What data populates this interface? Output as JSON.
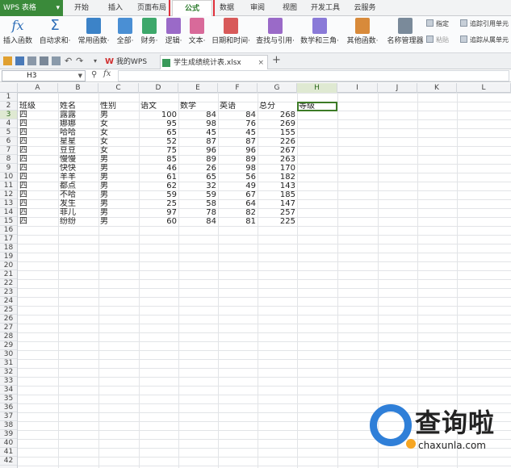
{
  "app": {
    "name": "WPS 表格",
    "caret": "▾"
  },
  "menu_tabs": [
    "开始",
    "插入",
    "页面布局",
    "公式",
    "数据",
    "审阅",
    "视图",
    "开发工具",
    "云服务"
  ],
  "ribbon": {
    "buttons": [
      {
        "label": "插入函数",
        "icon": "fx-icon"
      },
      {
        "label": "自动求和·",
        "icon": "sigma-icon"
      },
      {
        "label": "常用函数·",
        "icon": "star-function-icon"
      },
      {
        "label": "全部·",
        "icon": "book-icon"
      },
      {
        "label": "财务·",
        "icon": "finance-icon"
      },
      {
        "label": "逻辑·",
        "icon": "logic-icon"
      },
      {
        "label": "文本·",
        "icon": "text-icon"
      },
      {
        "label": "日期和时间·",
        "icon": "calendar-icon"
      },
      {
        "label": "查找与引用·",
        "icon": "lookup-icon"
      },
      {
        "label": "数学和三角·",
        "icon": "math-icon"
      },
      {
        "label": "其他函数·",
        "icon": "more-functions-icon"
      },
      {
        "label": "名称管理器",
        "icon": "name-manager-icon"
      }
    ],
    "small": [
      "指定",
      "粘贴",
      "追踪引用单元",
      "追踪从属单元"
    ]
  },
  "quickbar": {
    "tabs": [
      {
        "label": "我的WPS"
      },
      {
        "label": "学生成绩统计表.xlsx"
      }
    ],
    "close": "×",
    "add": "+"
  },
  "formula_bar": {
    "name_box": "H3",
    "fx": "fx",
    "value": ""
  },
  "columns": [
    "A",
    "B",
    "C",
    "D",
    "E",
    "F",
    "G",
    "H",
    "I",
    "J",
    "K",
    "L"
  ],
  "rows": [
    "1",
    "2",
    "3",
    "4",
    "5",
    "6",
    "7",
    "8",
    "9",
    "10",
    "11",
    "12",
    "13",
    "14",
    "15",
    "16",
    "17",
    "18",
    "19",
    "20",
    "21",
    "22",
    "23",
    "24",
    "25",
    "26",
    "27",
    "28",
    "29",
    "30",
    "31",
    "32",
    "33",
    "34",
    "35",
    "36",
    "37",
    "38",
    "39",
    "40",
    "41",
    "42"
  ],
  "header_row": [
    "班级",
    "姓名",
    "性别",
    "语文",
    "数学",
    "英语",
    "总分",
    "等级"
  ],
  "table": [
    [
      "四",
      "露露",
      "男",
      "100",
      "84",
      "84",
      "268"
    ],
    [
      "四",
      "娜娜",
      "女",
      "95",
      "98",
      "76",
      "269"
    ],
    [
      "四",
      "哈哈",
      "女",
      "65",
      "45",
      "45",
      "155"
    ],
    [
      "四",
      "星星",
      "女",
      "52",
      "87",
      "87",
      "226"
    ],
    [
      "四",
      "豆豆",
      "女",
      "75",
      "96",
      "96",
      "267"
    ],
    [
      "四",
      "慢慢",
      "男",
      "85",
      "89",
      "89",
      "263"
    ],
    [
      "四",
      "快快",
      "男",
      "46",
      "26",
      "98",
      "170"
    ],
    [
      "四",
      "羊羊",
      "男",
      "61",
      "65",
      "56",
      "182"
    ],
    [
      "四",
      "都点",
      "男",
      "62",
      "32",
      "49",
      "143"
    ],
    [
      "四",
      "不哈",
      "男",
      "59",
      "59",
      "67",
      "185"
    ],
    [
      "四",
      "发生",
      "男",
      "25",
      "58",
      "64",
      "147"
    ],
    [
      "四",
      "菲儿",
      "男",
      "97",
      "78",
      "82",
      "257"
    ],
    [
      "四",
      "纷纷",
      "男",
      "60",
      "84",
      "81",
      "225"
    ]
  ],
  "selected_cell": {
    "column": "H",
    "row": "3"
  },
  "watermark": {
    "brand": "查询啦",
    "url": "chaxunla.com"
  },
  "colors": {
    "app_green": "#3a8a3a",
    "highlight_red": "#e0303a",
    "selection_green": "#3c7b26",
    "watermark_blue": "#2f7fd8"
  }
}
